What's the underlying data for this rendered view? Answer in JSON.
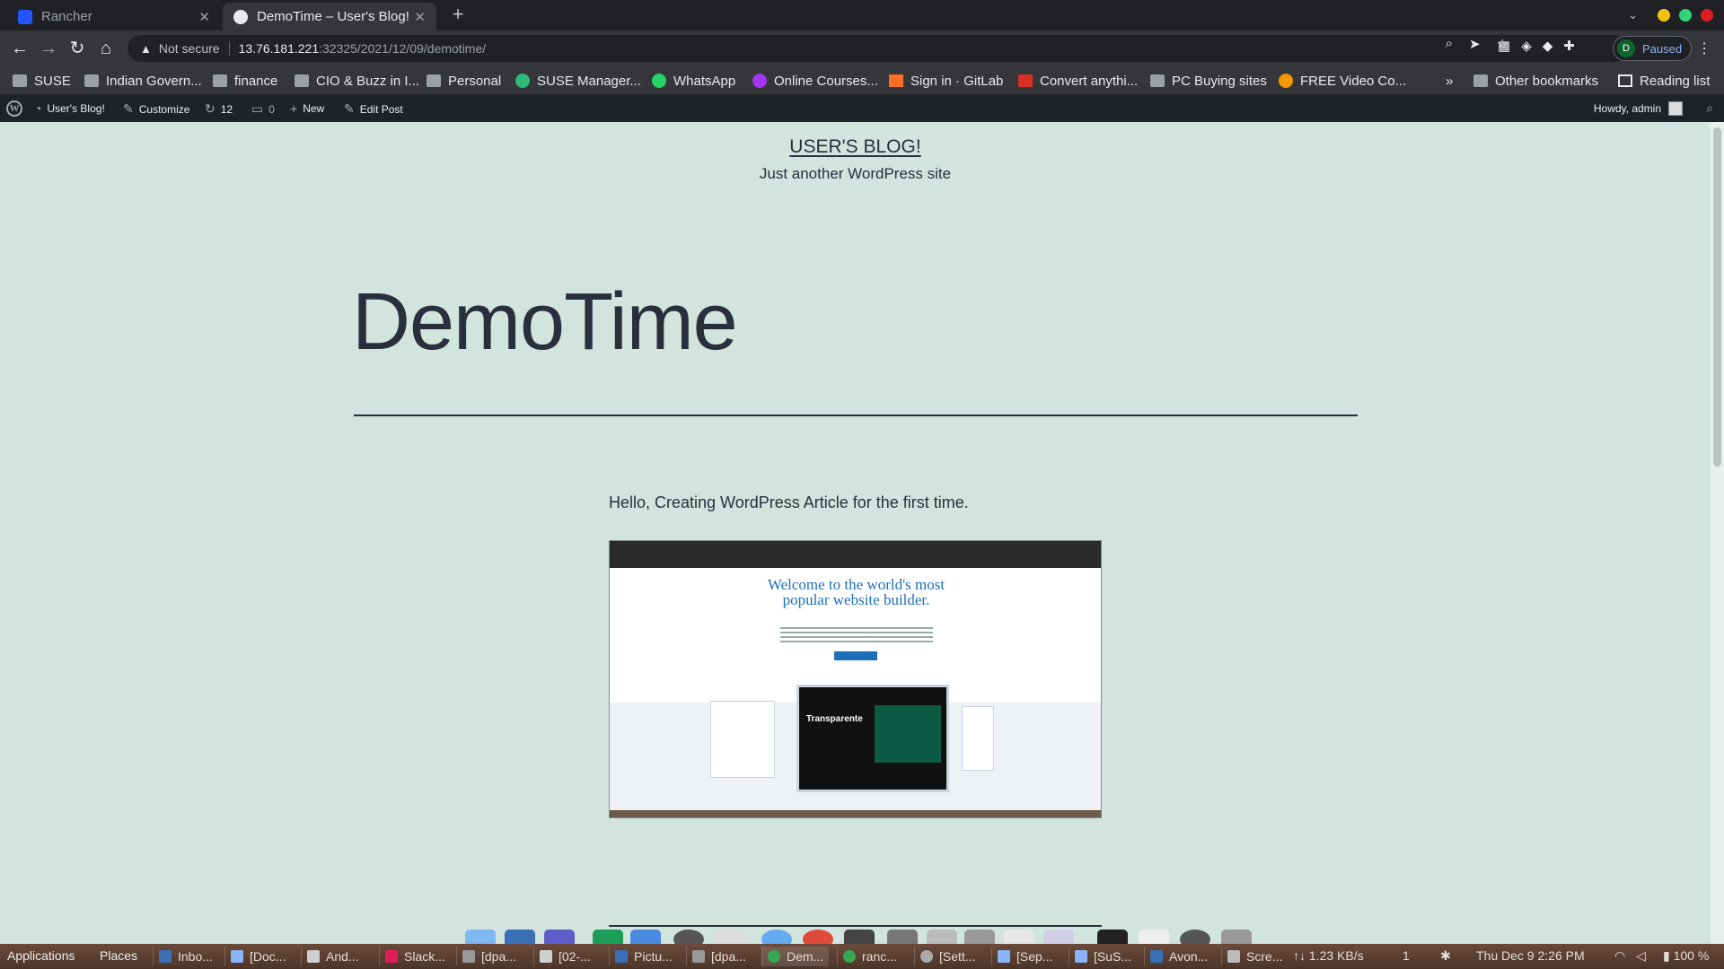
{
  "browser": {
    "tabs": [
      {
        "title": "Rancher",
        "active": false
      },
      {
        "title": "DemoTime – User's Blog!",
        "active": true
      }
    ],
    "new_tab": "+",
    "omnibox": {
      "security": "Not secure",
      "host": "13.76.181.221",
      "path": ":32325/2021/12/09/demotime/"
    },
    "profile": {
      "initial": "D",
      "status": "Paused"
    },
    "bookmarks": [
      {
        "label": "SUSE",
        "icon": "folder-icon"
      },
      {
        "label": "Indian Govern...",
        "icon": "folder-icon"
      },
      {
        "label": "finance",
        "icon": "folder-icon"
      },
      {
        "label": "CIO & Buzz in I...",
        "icon": "folder-icon"
      },
      {
        "label": "Personal",
        "icon": "folder-icon"
      },
      {
        "label": "SUSE Manager...",
        "icon": "suse-icon"
      },
      {
        "label": "WhatsApp",
        "icon": "whatsapp-icon"
      },
      {
        "label": "Online Courses...",
        "icon": "udemy-icon"
      },
      {
        "label": "Sign in · GitLab",
        "icon": "gitlab-icon"
      },
      {
        "label": "Convert anythi...",
        "icon": "convert-icon"
      },
      {
        "label": "PC Buying sites",
        "icon": "folder-icon"
      },
      {
        "label": "FREE Video Co...",
        "icon": "video-icon"
      }
    ],
    "bookmarks_overflow": "»",
    "other_bookmarks": "Other bookmarks",
    "reading_list": "Reading list"
  },
  "wp_admin_bar": {
    "site_name": "User's Blog!",
    "customize": "Customize",
    "updates_count": "12",
    "comments_count": "0",
    "new": "New",
    "edit_post": "Edit Post",
    "howdy": "Howdy, admin"
  },
  "page": {
    "site_title": "USER'S BLOG!",
    "site_description": "Just another WordPress site",
    "post_title": "DemoTime",
    "post_text": "Hello, Creating WordPress Article for the first time.",
    "embedded_screenshot": {
      "headline_line1": "Welcome to the world's most",
      "headline_line2": "popular website builder.",
      "laptop_label": "Transparente"
    }
  },
  "taskbar": {
    "applications": "Applications",
    "places": "Places",
    "windows": [
      {
        "label": "Inbo...",
        "color": "#3b6fb6"
      },
      {
        "label": "[Doc...",
        "color": "#8ab4f8"
      },
      {
        "label": "And...",
        "color": "#cfcfcf"
      },
      {
        "label": "Slack...",
        "color": "#e01e5a"
      },
      {
        "label": "[dpa...",
        "color": "#999999"
      },
      {
        "label": "[02-...",
        "color": "#cfcfcf"
      },
      {
        "label": "Pictu...",
        "color": "#3b6fb6"
      },
      {
        "label": "[dpa...",
        "color": "#999999"
      },
      {
        "label": "Dem...",
        "color": "#34a853"
      },
      {
        "label": "ranc...",
        "color": "#34a853"
      },
      {
        "label": "[Sett...",
        "color": "#aaaaaa"
      },
      {
        "label": "[Sep...",
        "color": "#8ab4f8"
      },
      {
        "label": "[SuS...",
        "color": "#8ab4f8"
      },
      {
        "label": "Avon...",
        "color": "#3b6fb6"
      },
      {
        "label": "Scre...",
        "color": "#bbbbbb"
      }
    ],
    "net_speed": "1.23 KB/s",
    "workspace": "1",
    "clock": "Thu Dec 9  2:26 PM",
    "battery": "100 %"
  }
}
